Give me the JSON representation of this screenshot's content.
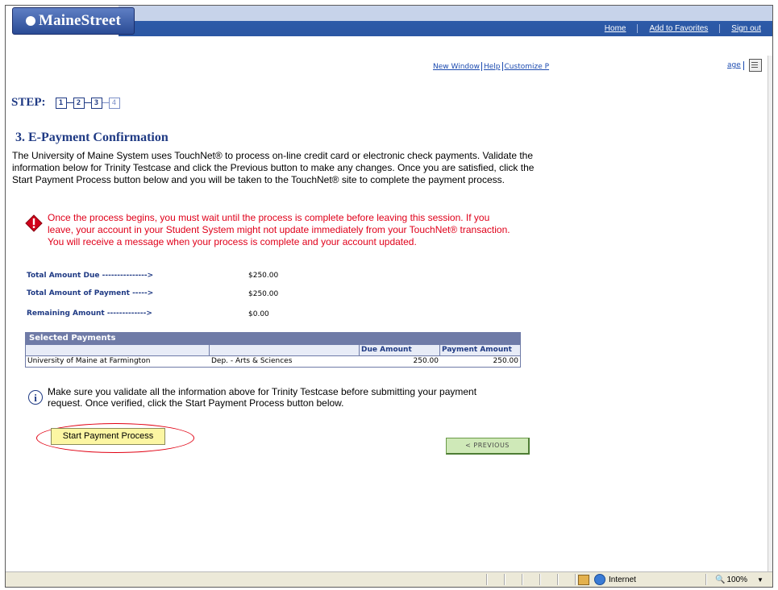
{
  "header": {
    "logo": "MaineStreet",
    "links": [
      "Home",
      "Add to Favorites",
      "Sign out"
    ]
  },
  "utility": {
    "new_window": "New Window",
    "help": "Help",
    "customize": "Customize P",
    "customize_tail": "age"
  },
  "steps": {
    "label": "STEP:",
    "items": [
      "1",
      "2",
      "3",
      "4"
    ],
    "current": 3
  },
  "page_title": "3. E-Payment Confirmation",
  "intro": "The University of Maine System uses TouchNet® to process on-line credit card or electronic check payments. Validate the information below for Trinity Testcase and click the Previous button to make any changes. Once you are satisfied, click the Start Payment Process button below and you will be taken to the TouchNet® site to complete the payment process.",
  "warning": "Once the process begins, you must wait until the process is complete before leaving this session. If you leave, your account in your Student System might not update immediately from your TouchNet® transaction. You will receive a message when your process is complete and your account updated.",
  "amounts": [
    {
      "label": "Total Amount Due --------------->",
      "value": "$250.00"
    },
    {
      "label": "Total Amount of Payment ----->",
      "value": "$250.00"
    },
    {
      "label": "Remaining Amount ------------->",
      "value": "$0.00"
    }
  ],
  "grid": {
    "title": "Selected Payments",
    "headers": [
      "",
      "",
      "Due Amount",
      "Payment Amount"
    ],
    "rows": [
      [
        "University of Maine at Farmington",
        "Dep. - Arts & Sciences",
        "250.00",
        "250.00"
      ]
    ]
  },
  "info": "Make sure you validate all the information above for Trinity Testcase before submitting your payment request. Once verified, click the Start Payment Process button below.",
  "buttons": {
    "start": "Start Payment Process",
    "previous": "< PREVIOUS"
  },
  "statusbar": {
    "zone": "Internet",
    "zoom": "100%"
  },
  "colors": {
    "accent": "#1f3a84",
    "warning": "#e0001a",
    "header_blue": "#2d5aa8"
  }
}
